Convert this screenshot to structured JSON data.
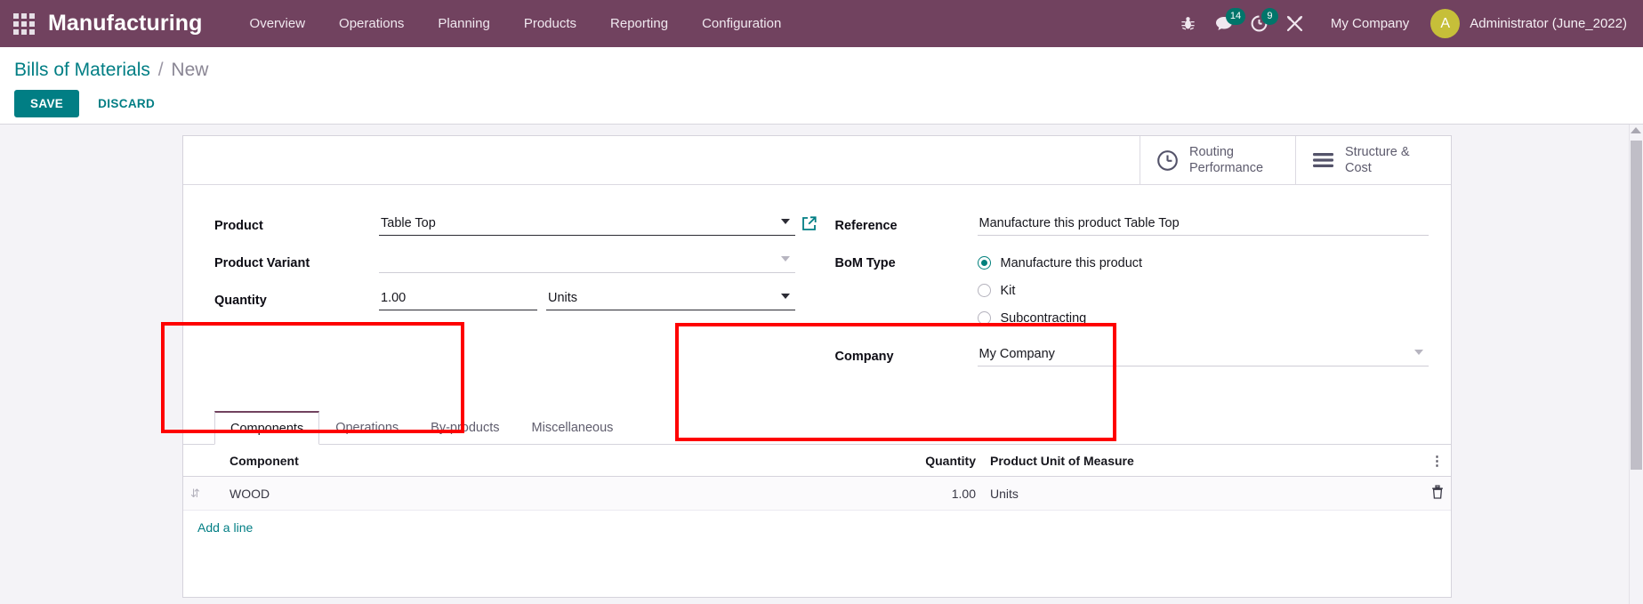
{
  "navbar": {
    "apps_icon": "apps-grid-icon",
    "brand": "Manufacturing",
    "menu": [
      {
        "label": "Overview"
      },
      {
        "label": "Operations"
      },
      {
        "label": "Planning"
      },
      {
        "label": "Products"
      },
      {
        "label": "Reporting"
      },
      {
        "label": "Configuration"
      }
    ],
    "icons": [
      {
        "name": "bug-icon",
        "glyph": "⚕",
        "badge": ""
      },
      {
        "name": "messages-icon",
        "glyph": "💬",
        "badge": "14"
      },
      {
        "name": "activities-icon",
        "glyph": "◔",
        "badge": "9"
      },
      {
        "name": "developer-tools-icon",
        "glyph": "⚒",
        "badge": ""
      }
    ],
    "company": "My Company",
    "avatar_letter": "A",
    "user": "Administrator (June_2022)",
    "accent_purple": "#71425f",
    "badge_color": "#00756a",
    "avatar_color": "#c6bf39"
  },
  "control_panel": {
    "breadcrumb_root": "Bills of Materials",
    "breadcrumb_sep": "/",
    "breadcrumb_current": "New",
    "save_label": "SAVE",
    "discard_label": "DISCARD",
    "save_color": "#017e84"
  },
  "stat_buttons": [
    {
      "icon": "clock-icon",
      "line1": "Routing",
      "line2": "Performance"
    },
    {
      "icon": "list-icon",
      "line1": "Structure &",
      "line2": "Cost"
    }
  ],
  "form": {
    "left": {
      "product_label": "Product",
      "product_value": "Table Top",
      "product_variant_label": "Product Variant",
      "product_variant_value": "",
      "quantity_label": "Quantity",
      "quantity_value": "1.00",
      "uom_value": "Units"
    },
    "right": {
      "reference_label": "Reference",
      "reference_value": "Manufacture this product Table Top",
      "bom_type_label": "BoM Type",
      "bom_type_options": [
        {
          "label": "Manufacture this product",
          "selected": true
        },
        {
          "label": "Kit",
          "selected": false
        },
        {
          "label": "Subcontracting",
          "selected": false
        }
      ],
      "company_label": "Company",
      "company_value": "My Company"
    }
  },
  "notebook": {
    "tabs": [
      {
        "label": "Components",
        "active": true
      },
      {
        "label": "Operations",
        "active": false
      },
      {
        "label": "By-products",
        "active": false
      },
      {
        "label": "Miscellaneous",
        "active": false
      }
    ],
    "columns": {
      "component": "Component",
      "quantity": "Quantity",
      "uom": "Product Unit of Measure"
    },
    "rows": [
      {
        "component": "WOOD",
        "quantity": "1.00",
        "uom": "Units"
      }
    ],
    "add_line_label": "Add a line"
  },
  "annotations": {
    "color": "#fe0000",
    "boxes": [
      {
        "name": "product-fields-highlight"
      },
      {
        "name": "bom-type-highlight"
      }
    ]
  }
}
